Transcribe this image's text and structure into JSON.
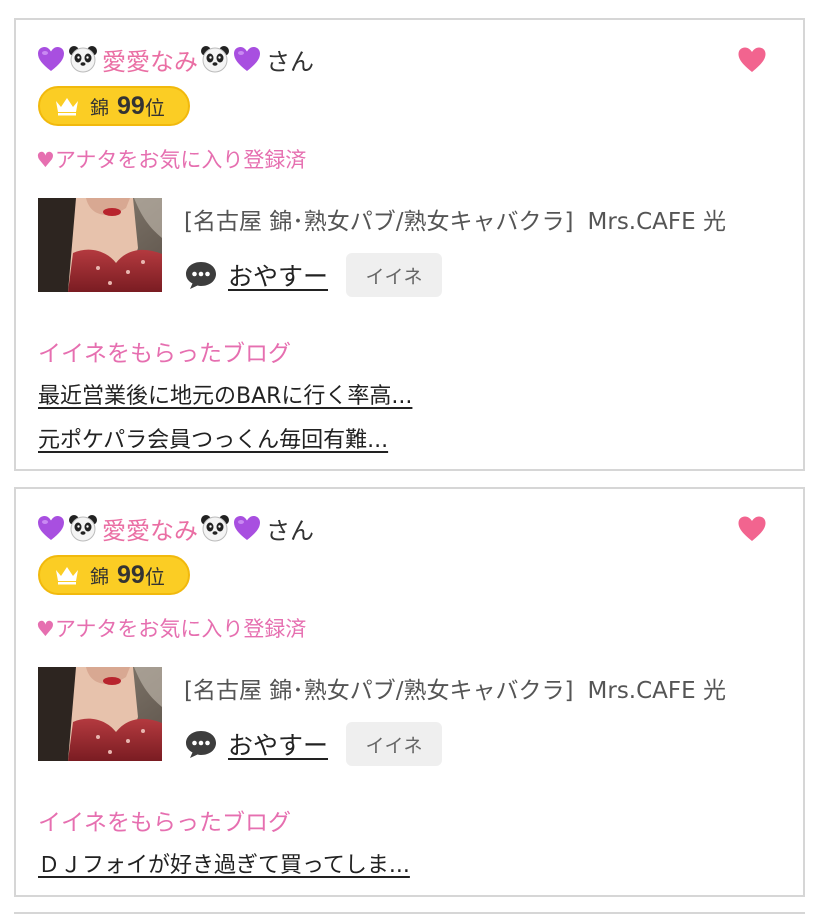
{
  "colors": {
    "accent_pink": "#e66fb0",
    "heart_pink": "#f2648f",
    "badge_gold": "#fbcd24",
    "border": "#d6d6d6",
    "button_gray": "#efefef"
  },
  "cards": [
    {
      "name": "愛愛なみ",
      "honorific": "さん",
      "name_icons": [
        "purple-heart-icon",
        "panda-icon",
        "panda-icon",
        "purple-heart-icon"
      ],
      "rank": {
        "area": "錦",
        "number": "99",
        "suffix": "位",
        "icon": "crown-icon"
      },
      "favorite_status": "♥アナタをお気に入り登録済",
      "shop_category": "[名古屋 錦･熟女パブ/熟女キャバクラ]",
      "shop_name": "Mrs.CAFE 光",
      "comment": "おやすー",
      "iine_label": "イイネ",
      "blog_heading": "イイネをもらったブログ",
      "blogs": [
        "最近営業後に地元のBARに行く率高...",
        "元ポケパラ会員つっくん毎回有難..."
      ]
    },
    {
      "name": "愛愛なみ",
      "honorific": "さん",
      "name_icons": [
        "purple-heart-icon",
        "panda-icon",
        "panda-icon",
        "purple-heart-icon"
      ],
      "rank": {
        "area": "錦",
        "number": "99",
        "suffix": "位",
        "icon": "crown-icon"
      },
      "favorite_status": "♥アナタをお気に入り登録済",
      "shop_category": "[名古屋 錦･熟女パブ/熟女キャバクラ]",
      "shop_name": "Mrs.CAFE 光",
      "comment": "おやすー",
      "iine_label": "イイネ",
      "blog_heading": "イイネをもらったブログ",
      "blogs": [
        "ＤＪフォイが好き過ぎて買ってしま..."
      ]
    }
  ]
}
